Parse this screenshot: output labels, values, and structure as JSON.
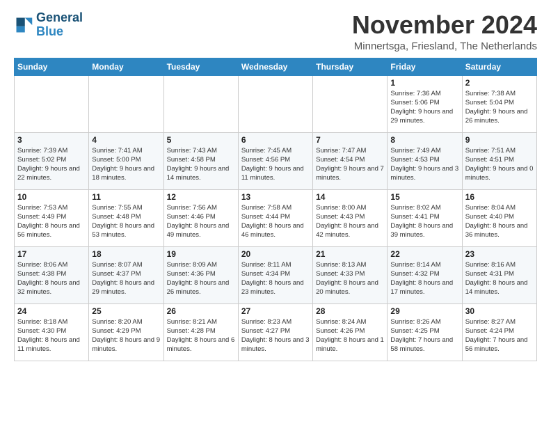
{
  "logo": {
    "line1": "General",
    "line2": "Blue"
  },
  "title": "November 2024",
  "subtitle": "Minnertsga, Friesland, The Netherlands",
  "days_of_week": [
    "Sunday",
    "Monday",
    "Tuesday",
    "Wednesday",
    "Thursday",
    "Friday",
    "Saturday"
  ],
  "weeks": [
    [
      {
        "day": "",
        "info": ""
      },
      {
        "day": "",
        "info": ""
      },
      {
        "day": "",
        "info": ""
      },
      {
        "day": "",
        "info": ""
      },
      {
        "day": "",
        "info": ""
      },
      {
        "day": "1",
        "info": "Sunrise: 7:36 AM\nSunset: 5:06 PM\nDaylight: 9 hours and 29 minutes."
      },
      {
        "day": "2",
        "info": "Sunrise: 7:38 AM\nSunset: 5:04 PM\nDaylight: 9 hours and 26 minutes."
      }
    ],
    [
      {
        "day": "3",
        "info": "Sunrise: 7:39 AM\nSunset: 5:02 PM\nDaylight: 9 hours and 22 minutes."
      },
      {
        "day": "4",
        "info": "Sunrise: 7:41 AM\nSunset: 5:00 PM\nDaylight: 9 hours and 18 minutes."
      },
      {
        "day": "5",
        "info": "Sunrise: 7:43 AM\nSunset: 4:58 PM\nDaylight: 9 hours and 14 minutes."
      },
      {
        "day": "6",
        "info": "Sunrise: 7:45 AM\nSunset: 4:56 PM\nDaylight: 9 hours and 11 minutes."
      },
      {
        "day": "7",
        "info": "Sunrise: 7:47 AM\nSunset: 4:54 PM\nDaylight: 9 hours and 7 minutes."
      },
      {
        "day": "8",
        "info": "Sunrise: 7:49 AM\nSunset: 4:53 PM\nDaylight: 9 hours and 3 minutes."
      },
      {
        "day": "9",
        "info": "Sunrise: 7:51 AM\nSunset: 4:51 PM\nDaylight: 9 hours and 0 minutes."
      }
    ],
    [
      {
        "day": "10",
        "info": "Sunrise: 7:53 AM\nSunset: 4:49 PM\nDaylight: 8 hours and 56 minutes."
      },
      {
        "day": "11",
        "info": "Sunrise: 7:55 AM\nSunset: 4:48 PM\nDaylight: 8 hours and 53 minutes."
      },
      {
        "day": "12",
        "info": "Sunrise: 7:56 AM\nSunset: 4:46 PM\nDaylight: 8 hours and 49 minutes."
      },
      {
        "day": "13",
        "info": "Sunrise: 7:58 AM\nSunset: 4:44 PM\nDaylight: 8 hours and 46 minutes."
      },
      {
        "day": "14",
        "info": "Sunrise: 8:00 AM\nSunset: 4:43 PM\nDaylight: 8 hours and 42 minutes."
      },
      {
        "day": "15",
        "info": "Sunrise: 8:02 AM\nSunset: 4:41 PM\nDaylight: 8 hours and 39 minutes."
      },
      {
        "day": "16",
        "info": "Sunrise: 8:04 AM\nSunset: 4:40 PM\nDaylight: 8 hours and 36 minutes."
      }
    ],
    [
      {
        "day": "17",
        "info": "Sunrise: 8:06 AM\nSunset: 4:38 PM\nDaylight: 8 hours and 32 minutes."
      },
      {
        "day": "18",
        "info": "Sunrise: 8:07 AM\nSunset: 4:37 PM\nDaylight: 8 hours and 29 minutes."
      },
      {
        "day": "19",
        "info": "Sunrise: 8:09 AM\nSunset: 4:36 PM\nDaylight: 8 hours and 26 minutes."
      },
      {
        "day": "20",
        "info": "Sunrise: 8:11 AM\nSunset: 4:34 PM\nDaylight: 8 hours and 23 minutes."
      },
      {
        "day": "21",
        "info": "Sunrise: 8:13 AM\nSunset: 4:33 PM\nDaylight: 8 hours and 20 minutes."
      },
      {
        "day": "22",
        "info": "Sunrise: 8:14 AM\nSunset: 4:32 PM\nDaylight: 8 hours and 17 minutes."
      },
      {
        "day": "23",
        "info": "Sunrise: 8:16 AM\nSunset: 4:31 PM\nDaylight: 8 hours and 14 minutes."
      }
    ],
    [
      {
        "day": "24",
        "info": "Sunrise: 8:18 AM\nSunset: 4:30 PM\nDaylight: 8 hours and 11 minutes."
      },
      {
        "day": "25",
        "info": "Sunrise: 8:20 AM\nSunset: 4:29 PM\nDaylight: 8 hours and 9 minutes."
      },
      {
        "day": "26",
        "info": "Sunrise: 8:21 AM\nSunset: 4:28 PM\nDaylight: 8 hours and 6 minutes."
      },
      {
        "day": "27",
        "info": "Sunrise: 8:23 AM\nSunset: 4:27 PM\nDaylight: 8 hours and 3 minutes."
      },
      {
        "day": "28",
        "info": "Sunrise: 8:24 AM\nSunset: 4:26 PM\nDaylight: 8 hours and 1 minute."
      },
      {
        "day": "29",
        "info": "Sunrise: 8:26 AM\nSunset: 4:25 PM\nDaylight: 7 hours and 58 minutes."
      },
      {
        "day": "30",
        "info": "Sunrise: 8:27 AM\nSunset: 4:24 PM\nDaylight: 7 hours and 56 minutes."
      }
    ]
  ]
}
